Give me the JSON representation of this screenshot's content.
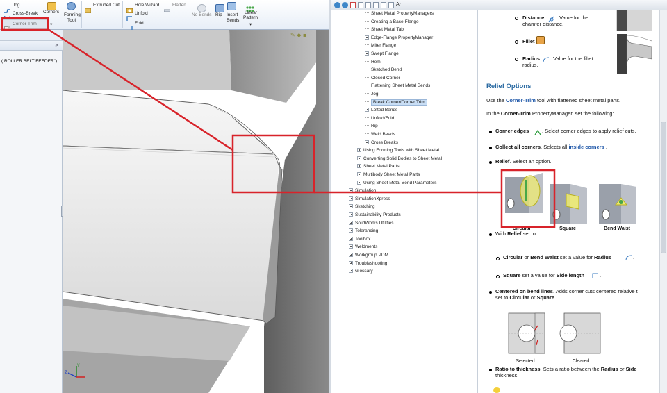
{
  "ribbon": {
    "jog": "Jog",
    "cross_break": "Cross-Break",
    "corner_trim": "Corner-Trim",
    "corners": "Corners",
    "forming_tool_1": "Forming",
    "forming_tool_2": "Tool",
    "extruded_cut": "Extruded Cut",
    "hole_wizard": "Hole Wizard",
    "flatten": "Flatten",
    "unfold": "Unfold",
    "fold": "Fold",
    "no_bends": "No Bends",
    "rip": "Rip",
    "insert_bends_1": "Insert",
    "insert_bends_2": "Bends",
    "linear_pattern_1": "Linear",
    "linear_pattern_2": "Pattern"
  },
  "feature_manager": {
    "expand_glyph": "»",
    "part_text": "( ROLLER BELT FEEDER\")"
  },
  "help_toolbar": {
    "font_label": "A·"
  },
  "toc": [
    {
      "label": "Sheet Metal PropertyManagers",
      "box": false
    },
    {
      "label": "Creating a Base-Flange",
      "box": false
    },
    {
      "label": "Sheet Metal Tab",
      "box": false
    },
    {
      "label": "Edge-Flange PropertyManager",
      "box": true
    },
    {
      "label": "Miter Flange",
      "box": false
    },
    {
      "label": "Swept Flange",
      "box": true
    },
    {
      "label": "Hem",
      "box": false
    },
    {
      "label": "Sketched Bend",
      "box": false
    },
    {
      "label": "Closed Corner",
      "box": false
    },
    {
      "label": "Flattening Sheet Metal Bends",
      "box": false
    },
    {
      "label": "Jog",
      "box": false
    },
    {
      "label": "Break Corner/Corner Trim",
      "box": false,
      "selected": true
    },
    {
      "label": "Lofted Bends",
      "box": true
    },
    {
      "label": "Unfold/Fold",
      "box": false
    },
    {
      "label": "Rip",
      "box": false
    },
    {
      "label": "Weld Beads",
      "box": false
    },
    {
      "label": "Cross Breaks",
      "box": true
    },
    {
      "label": "Using Forming Tools with Sheet Metal",
      "box": true
    },
    {
      "label": "Converting Solid Bodies to Sheet Metal",
      "box": true
    },
    {
      "label": "Sheet Metal Parts",
      "box": true
    },
    {
      "label": "Multibody Sheet Metal Parts",
      "box": true
    },
    {
      "label": "Using Sheet Metal Bend Parameters",
      "box": true
    },
    {
      "label": "Simulation",
      "box": true
    },
    {
      "label": "SimulationXpress",
      "box": true
    },
    {
      "label": "Sketching",
      "box": true
    },
    {
      "label": "Sustainability Products",
      "box": true
    },
    {
      "label": "SolidWorks Utilities",
      "box": true
    },
    {
      "label": "Tolerancing",
      "box": true
    },
    {
      "label": "Toolbox",
      "box": true
    },
    {
      "label": "Weldments",
      "box": true
    },
    {
      "label": "Workgroup PDM",
      "box": true
    },
    {
      "label": "Troubleshooting",
      "box": true
    },
    {
      "label": "Glossary",
      "box": true
    }
  ],
  "content": {
    "distance_label": "Distance",
    "distance_desc_1": ". Value for the",
    "distance_desc_2": "chamfer distance.",
    "fillet_label": "Fillet",
    "radius_label": "Radius",
    "radius_desc_1": ". Value for the fillet",
    "radius_desc_2": "radius.",
    "section_title": "Relief Options",
    "intro_pre": "Use the ",
    "intro_link": "Corner-Trim",
    "intro_post": " tool with flattened sheet metal parts.",
    "pm_pre": "In the ",
    "pm_bold": "Corner-Trim",
    "pm_post": " PropertyManager, set the following:",
    "corner_edges_label": "Corner edges",
    "corner_edges_desc": ". Select corner edges to apply relief cuts.",
    "collect_label": "Collect all corners",
    "collect_desc": ". Selects all ",
    "collect_link": "inside corners",
    "collect_end": " .",
    "relief_label": "Relief",
    "relief_desc": ". Select an option.",
    "relief_options": [
      "Circular",
      "Square",
      "Bend Waist"
    ],
    "with_relief_pre": "With ",
    "with_relief_bold": "Relief",
    "with_relief_post": " set to:",
    "sub1_a": "Circular",
    "sub1_b": " or ",
    "sub1_c": "Bend Waist",
    "sub1_d": " set a value for ",
    "sub1_e": "Radius",
    "sub1_f": " .",
    "sub2_a": "Square",
    "sub2_b": " set a value for ",
    "sub2_c": "Side length",
    "sub2_d": " .",
    "centered_label": "Centered on bend lines",
    "centered_desc_1": ". Adds corner cuts centered relative t",
    "centered_desc_2_pre": "set to ",
    "centered_desc_2_a": "Circular",
    "centered_desc_2_b": " or ",
    "centered_desc_2_c": "Square",
    "centered_desc_2_d": ".",
    "selected_caption": "Selected",
    "cleared_caption": "Cleared",
    "ratio_label": "Ratio to thickness",
    "ratio_desc_1": ". Sets a ratio between the ",
    "ratio_radius": "Radius",
    "ratio_or": " or ",
    "ratio_side": "Side",
    "ratio_desc_2": "thickness."
  },
  "colors": {
    "annotation_red": "#d8232a",
    "link_blue": "#1d56a8",
    "section_blue": "#2a6aa2",
    "toc_selected": "#c9def5"
  }
}
